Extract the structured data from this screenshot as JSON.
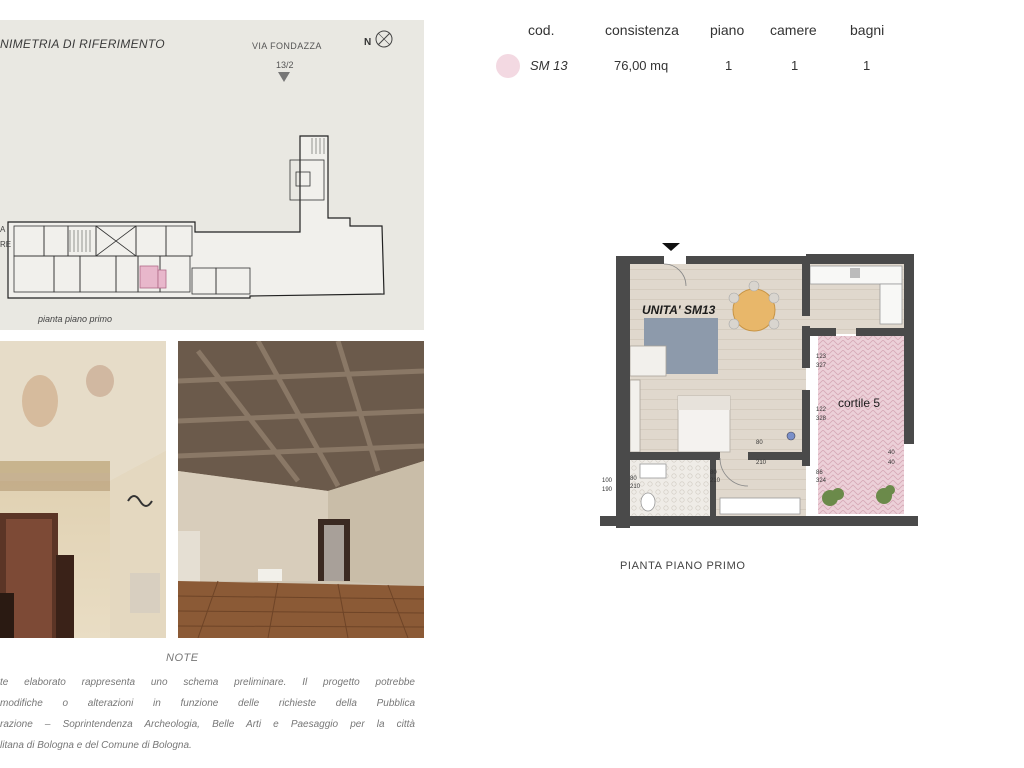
{
  "reference": {
    "title": "NIMETRIA DI RIFERIMENTO",
    "street_name": "VIA FONDAZZA",
    "street_number": "13/2",
    "north_label": "N",
    "caption": "pianta piano primo",
    "side_fragment_1": "A",
    "side_fragment_2": "RE"
  },
  "table": {
    "headers": {
      "code": "cod.",
      "size": "consistenza",
      "floor": "piano",
      "rooms": "camere",
      "baths": "bagni"
    },
    "row": {
      "code": "SM 13",
      "size": "76,00 mq",
      "floor": "1",
      "rooms": "1",
      "baths": "1",
      "swatch_color": "#f3d9e2"
    }
  },
  "floorplan": {
    "unit_label": "UNITA' SM13",
    "courtyard_label": "cortile 5",
    "caption": "PIANTA PIANO PRIMO",
    "dimensions": {
      "d1": "123",
      "d1b": "327",
      "d2": "122",
      "d2b": "328",
      "d3": "80",
      "d3b": "210",
      "d4": "80",
      "d4b": "210",
      "d5": "86",
      "d5b": "324",
      "d6": "40",
      "d6b": "40",
      "d7": "100",
      "d7b": "190",
      "d8": "80",
      "d8b": "210"
    }
  },
  "notes": {
    "title": "NOTE",
    "lines": [
      "te elaborato rappresenta uno schema preliminare. Il progetto potrebbe",
      "modifiche o alterazioni in funzione delle richieste della Pubblica",
      "razione – Soprintendenza Archeologia, Belle Arti e Paesaggio per la città",
      "litana di Bologna e del Comune di Bologna."
    ]
  },
  "colors": {
    "panel_bg": "#e9e8e2",
    "wall": "#4a4a4a",
    "floor_wood": "#e2dad0",
    "courtyard": "#e8c8d0",
    "rug": "#8a97a8",
    "table": "#e9b86a"
  }
}
